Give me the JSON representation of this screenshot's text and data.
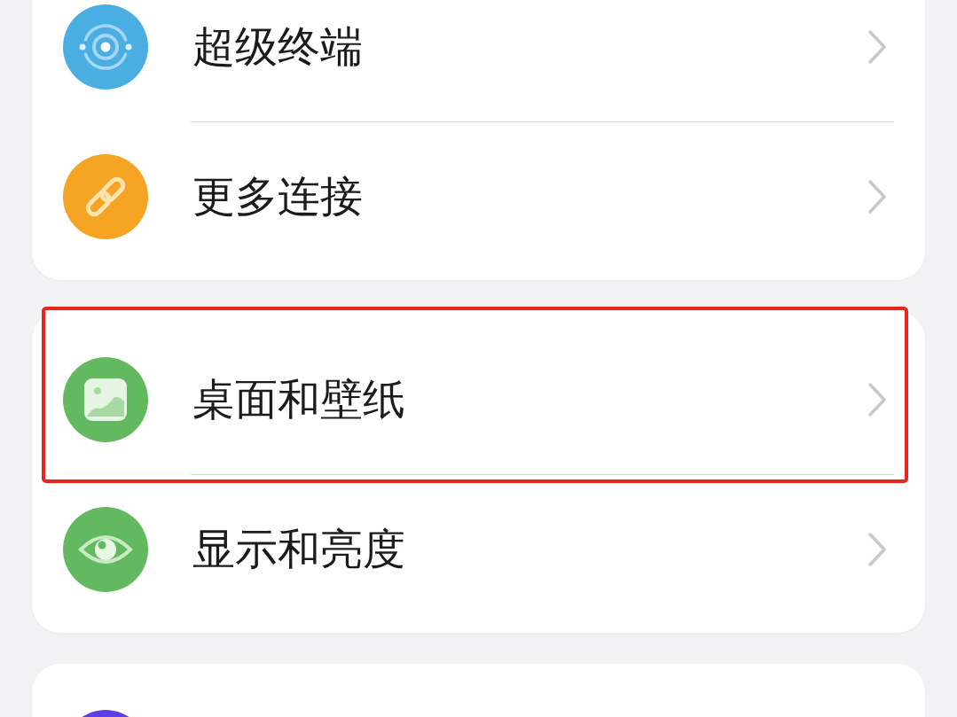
{
  "groups": [
    {
      "items": [
        {
          "kind": "rings",
          "color": "#4aaee3",
          "label": "超级终端",
          "highlighted": false
        },
        {
          "kind": "link",
          "color": "#f5a424",
          "label": "更多连接",
          "highlighted": false
        }
      ]
    },
    {
      "items": [
        {
          "kind": "image",
          "color": "#63b95f",
          "label": "桌面和壁纸",
          "highlighted": true
        },
        {
          "kind": "eye",
          "color": "#63b95f",
          "label": "显示和亮度",
          "highlighted": false
        }
      ]
    },
    {
      "items": [
        {
          "kind": "clipped",
          "color": "#5b3fe3"
        }
      ]
    }
  ]
}
